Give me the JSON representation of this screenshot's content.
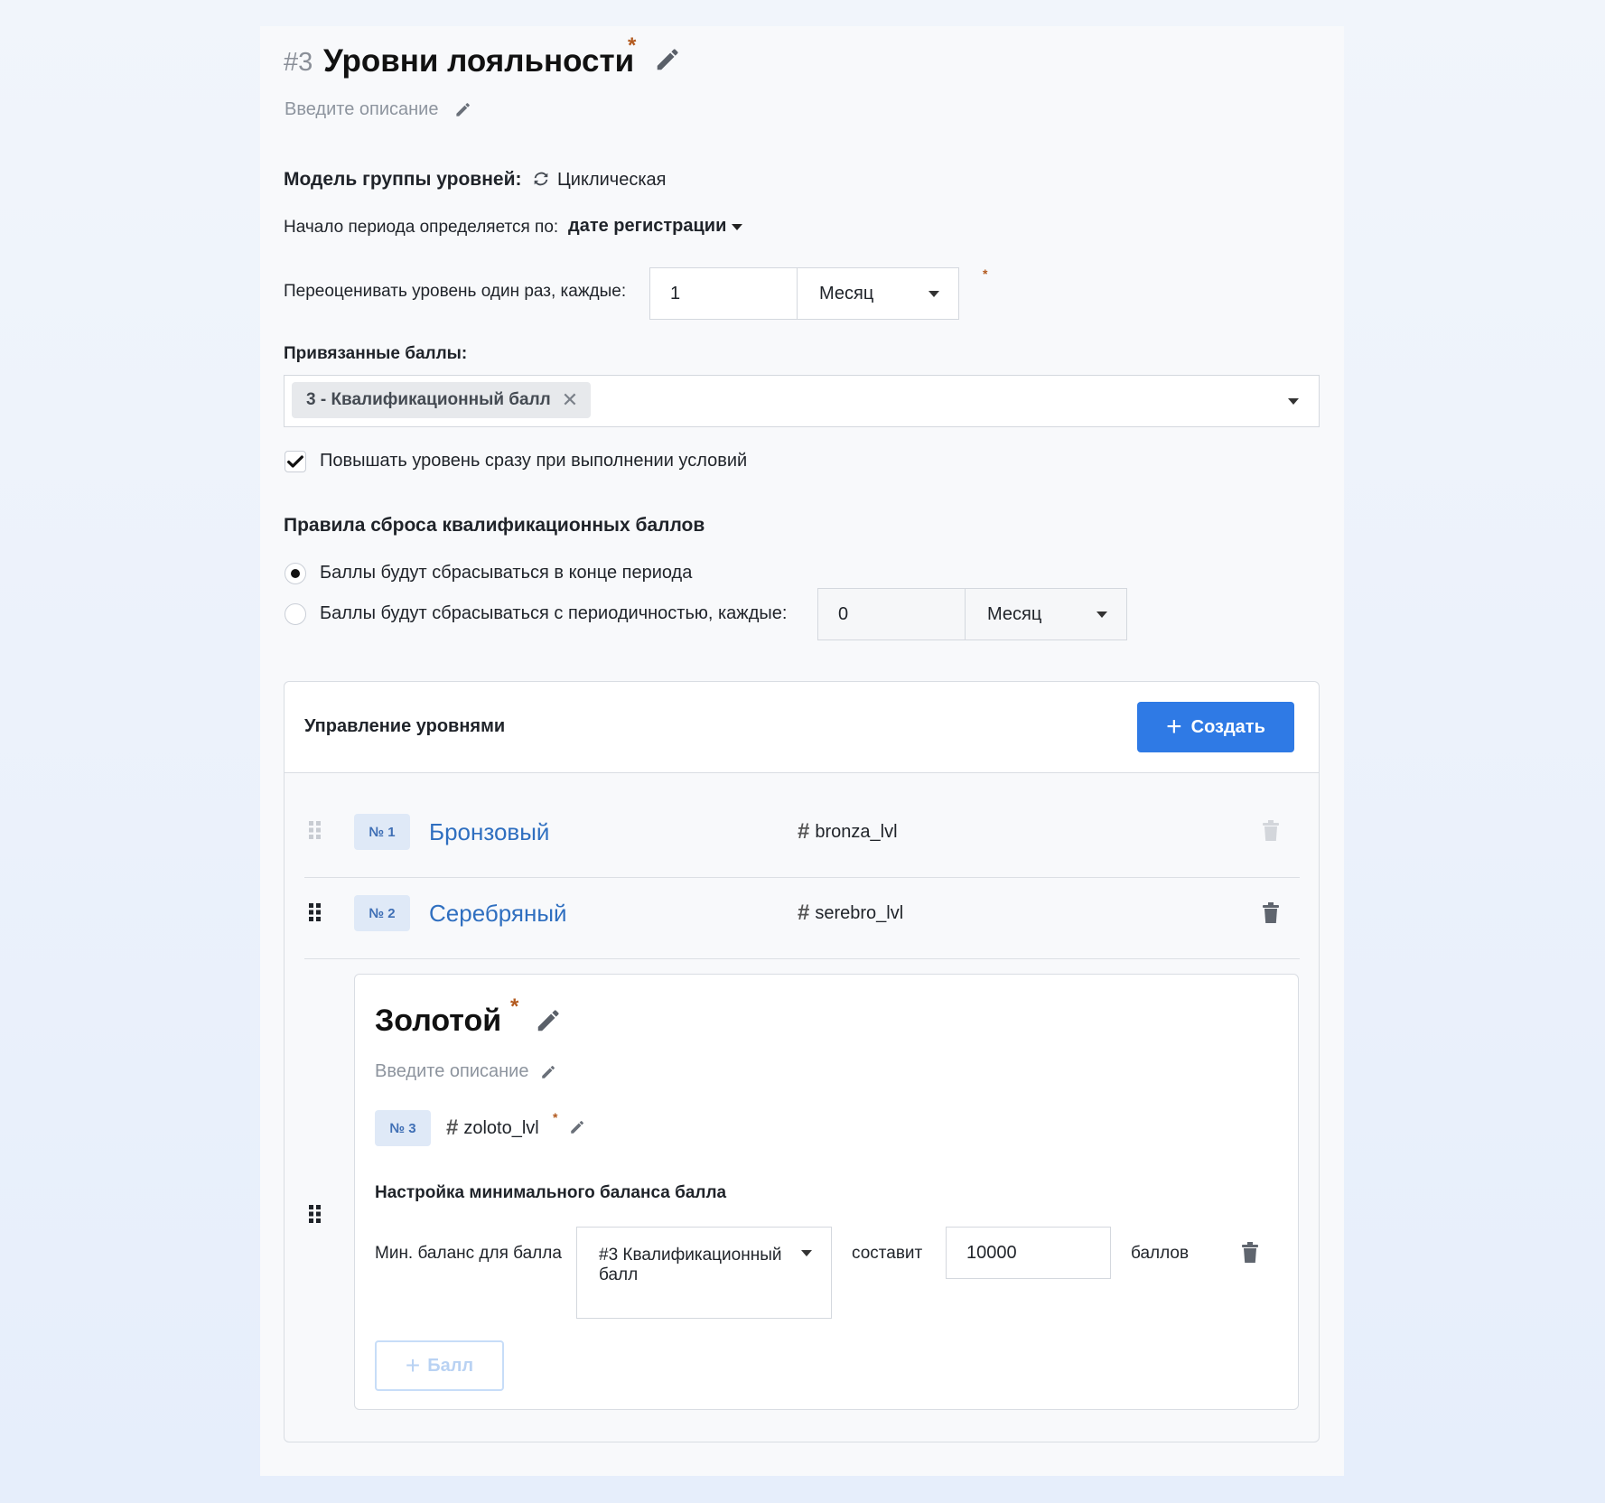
{
  "header": {
    "number": "#3",
    "title": "Уровни лояльности",
    "required_mark": "*",
    "description_placeholder": "Введите описание"
  },
  "model": {
    "label": "Модель группы уровней:",
    "value": "Циклическая"
  },
  "period_start": {
    "label": "Начало периода определяется по:",
    "value": "дате регистрации"
  },
  "reevaluate": {
    "label": "Переоценивать уровень один раз, каждые:",
    "count": "1",
    "unit": "Месяц",
    "required_mark": "*"
  },
  "bound_points": {
    "label": "Привязанные баллы:",
    "tags": [
      "3 - Квалификационный балл"
    ]
  },
  "instant_upgrade": {
    "label": "Повышать уровень сразу при выполнении условий",
    "checked": true
  },
  "reset_rules": {
    "title": "Правила сброса квалификационных баллов",
    "options": [
      {
        "label": "Баллы будут сбрасываться в конце периода",
        "selected": true
      },
      {
        "label": "Баллы будут сбрасываться с периодичностью, каждые:",
        "selected": false
      }
    ],
    "count": "0",
    "unit": "Месяц"
  },
  "levels_manager": {
    "title": "Управление уровнями",
    "create_button": "Создать",
    "levels": [
      {
        "badge": "№ 1",
        "name": "Бронзовый",
        "code": "bronza_lvl"
      },
      {
        "badge": "№ 2",
        "name": "Серебряный",
        "code": "serebro_lvl"
      }
    ],
    "expanded_level": {
      "name": "Золотой",
      "required_mark": "*",
      "description_placeholder": "Введите описание",
      "badge": "№ 3",
      "code": "zoloto_lvl",
      "min_balance_title": "Настройка минимального баланса балла",
      "min_balance_label": "Мин. баланс для балла",
      "points_select": "#3 Квалификационный балл",
      "will_be": "составит",
      "amount": "10000",
      "unit": "баллов",
      "add_point_button": "Балл"
    }
  },
  "colors": {
    "accent": "#2f7ae5",
    "level_name": "#2f6fc0",
    "required_star": "#b35a1f"
  }
}
